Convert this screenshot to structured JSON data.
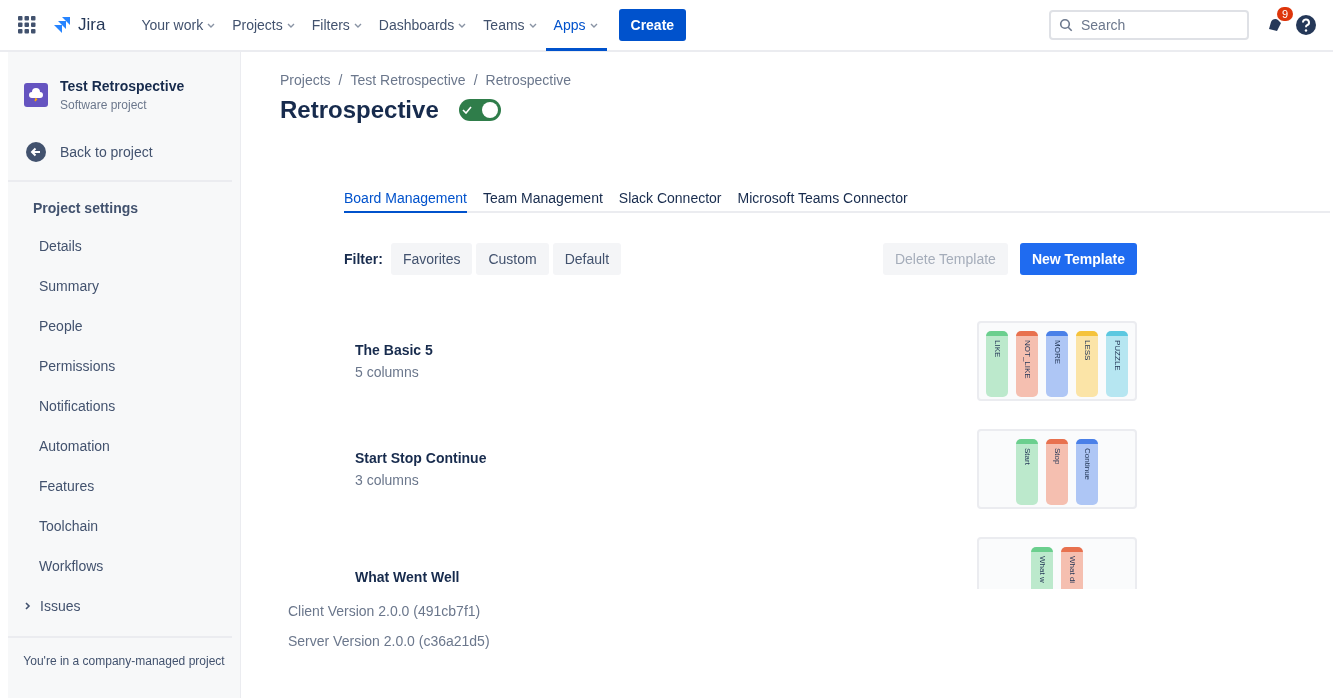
{
  "nav": {
    "product": "Jira",
    "items": [
      {
        "label": "Your work",
        "selected": false
      },
      {
        "label": "Projects",
        "selected": false
      },
      {
        "label": "Filters",
        "selected": false
      },
      {
        "label": "Dashboards",
        "selected": false
      },
      {
        "label": "Teams",
        "selected": false
      },
      {
        "label": "Apps",
        "selected": true
      }
    ],
    "create": "Create",
    "search": {
      "placeholder": "Search"
    },
    "notifications": "9"
  },
  "sidebar": {
    "project": {
      "name": "Test Retrospective",
      "type": "Software project"
    },
    "back": "Back to project",
    "heading": "Project settings",
    "items": [
      {
        "label": "Details",
        "kind": "link"
      },
      {
        "label": "Summary",
        "kind": "link"
      },
      {
        "label": "People",
        "kind": "link"
      },
      {
        "label": "Permissions",
        "kind": "link"
      },
      {
        "label": "Notifications",
        "kind": "link"
      },
      {
        "label": "Automation",
        "kind": "link"
      },
      {
        "label": "Features",
        "kind": "link"
      },
      {
        "label": "Toolchain",
        "kind": "link"
      },
      {
        "label": "Workflows",
        "kind": "link"
      },
      {
        "label": "Issues",
        "kind": "group",
        "expanded": false
      }
    ],
    "footer": "You're in a company-managed project"
  },
  "breadcrumbs": {
    "separator": "/",
    "items": [
      "Projects",
      "Test Retrospective",
      "Retrospective"
    ]
  },
  "page": {
    "title": "Retrospective",
    "enabled": true
  },
  "tabs": [
    {
      "label": "Board Management",
      "selected": true
    },
    {
      "label": "Team Management",
      "selected": false
    },
    {
      "label": "Slack Connector",
      "selected": false
    },
    {
      "label": "Microsoft Teams Connector",
      "selected": false
    }
  ],
  "filter": {
    "label": "Filter:",
    "options": [
      "Favorites",
      "Custom",
      "Default"
    ]
  },
  "actions": [
    {
      "label": "Delete Template",
      "disabled": true,
      "kind": "secondary"
    },
    {
      "label": "New Template",
      "disabled": false,
      "kind": "primary"
    }
  ],
  "templates": [
    {
      "name": "The Basic 5",
      "subtitle": "5 columns",
      "columns": [
        {
          "label": "LIKE",
          "color": "#6bcf8e"
        },
        {
          "label": "NOT_LIKE",
          "color": "#e8714f"
        },
        {
          "label": "MORE",
          "color": "#4a80e8"
        },
        {
          "label": "LESS",
          "color": "#f5c33b"
        },
        {
          "label": "PUZZLE",
          "color": "#5cc8e0"
        }
      ]
    },
    {
      "name": "Start Stop Continue",
      "subtitle": "3 columns",
      "columns": [
        {
          "label": "Start",
          "color": "#6bcf8e"
        },
        {
          "label": "Stop",
          "color": "#e8714f"
        },
        {
          "label": "Continue",
          "color": "#4a80e8"
        }
      ]
    },
    {
      "name": "What Went Well",
      "columns": [
        {
          "label": "What w",
          "color": "#6bcf8e"
        },
        {
          "label": "What di",
          "color": "#e8714f"
        }
      ]
    }
  ],
  "versions": [
    "Client Version 2.0.0 (491cb7f1)",
    "Server Version 2.0.0 (c36a21d5)"
  ]
}
